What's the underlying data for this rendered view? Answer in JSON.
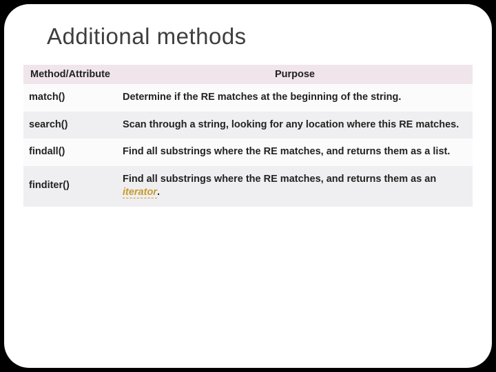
{
  "title": "Additional methods",
  "table": {
    "headers": {
      "method": "Method/Attribute",
      "purpose": "Purpose"
    },
    "rows": [
      {
        "method": "match()",
        "purpose": "Determine if the RE matches at the beginning of the string."
      },
      {
        "method": "search()",
        "purpose": "Scan through a string, looking for any location where this RE matches."
      },
      {
        "method": "findall()",
        "purpose": "Find all substrings where the RE matches, and returns them as a list."
      },
      {
        "method": "finditer()",
        "purpose_prefix": "Find all substrings where the RE matches, and returns them as an ",
        "purpose_link": "iterator",
        "purpose_suffix": "."
      }
    ]
  }
}
